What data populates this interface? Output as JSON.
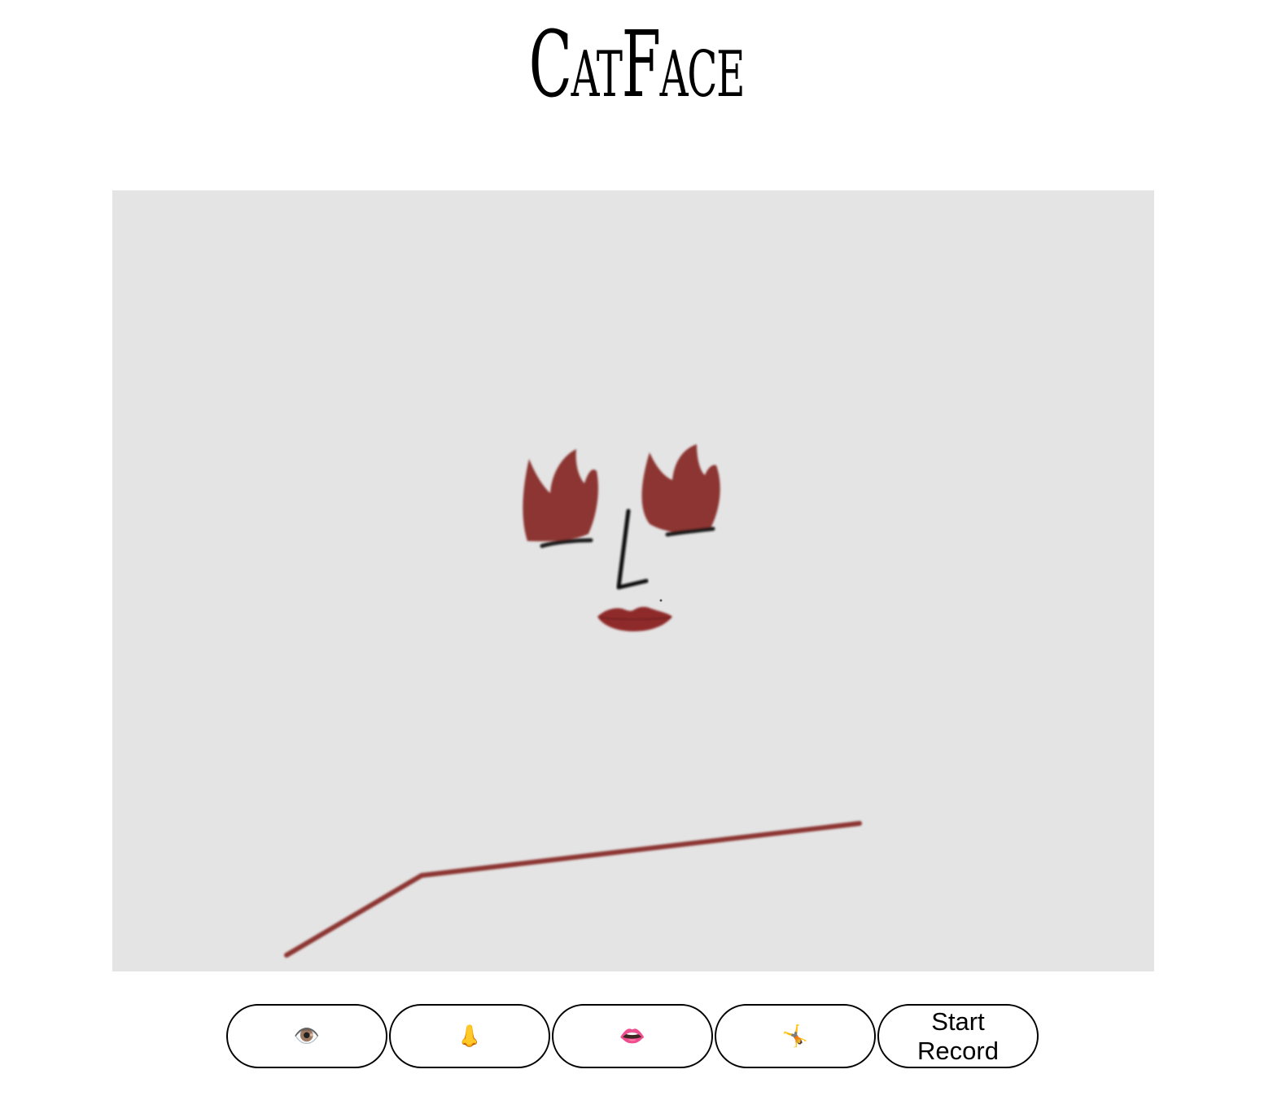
{
  "header": {
    "title": "CatFace"
  },
  "stage": {
    "background_color": "#e4e4e4",
    "accent_color": "#8c3632",
    "stroke_color": "#1a1a1a"
  },
  "controls": {
    "eye_button": {
      "icon": "eye-icon",
      "glyph": "👁️"
    },
    "nose_button": {
      "icon": "nose-icon",
      "glyph": "👃"
    },
    "lips_button": {
      "icon": "lips-icon",
      "glyph": "👄"
    },
    "cartwheel_button": {
      "icon": "cartwheel-icon",
      "glyph": "🤸"
    },
    "record_button": {
      "label": "Start\nRecord"
    }
  }
}
